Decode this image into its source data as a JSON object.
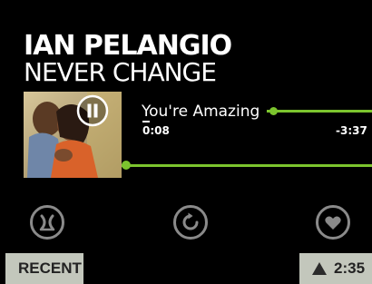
{
  "now_playing": {
    "artist": "IAN PELANGIO",
    "album": "NEVER CHANGE",
    "track_title": "You're Amazing",
    "elapsed": "0:08",
    "remaining": "-3:37",
    "playback_state": "playing",
    "album_art": "couple-portrait-image"
  },
  "controls": {
    "pause_icon": "pause-icon",
    "left_icon": "genius-mix-icon",
    "center_icon": "repeat-icon",
    "right_icon": "heart-icon"
  },
  "footer": {
    "recent_label": "RECENT",
    "time": "2:35"
  },
  "colors": {
    "accent": "#7cc42e",
    "background": "#000000",
    "footer_bg": "#c3c7bc"
  }
}
